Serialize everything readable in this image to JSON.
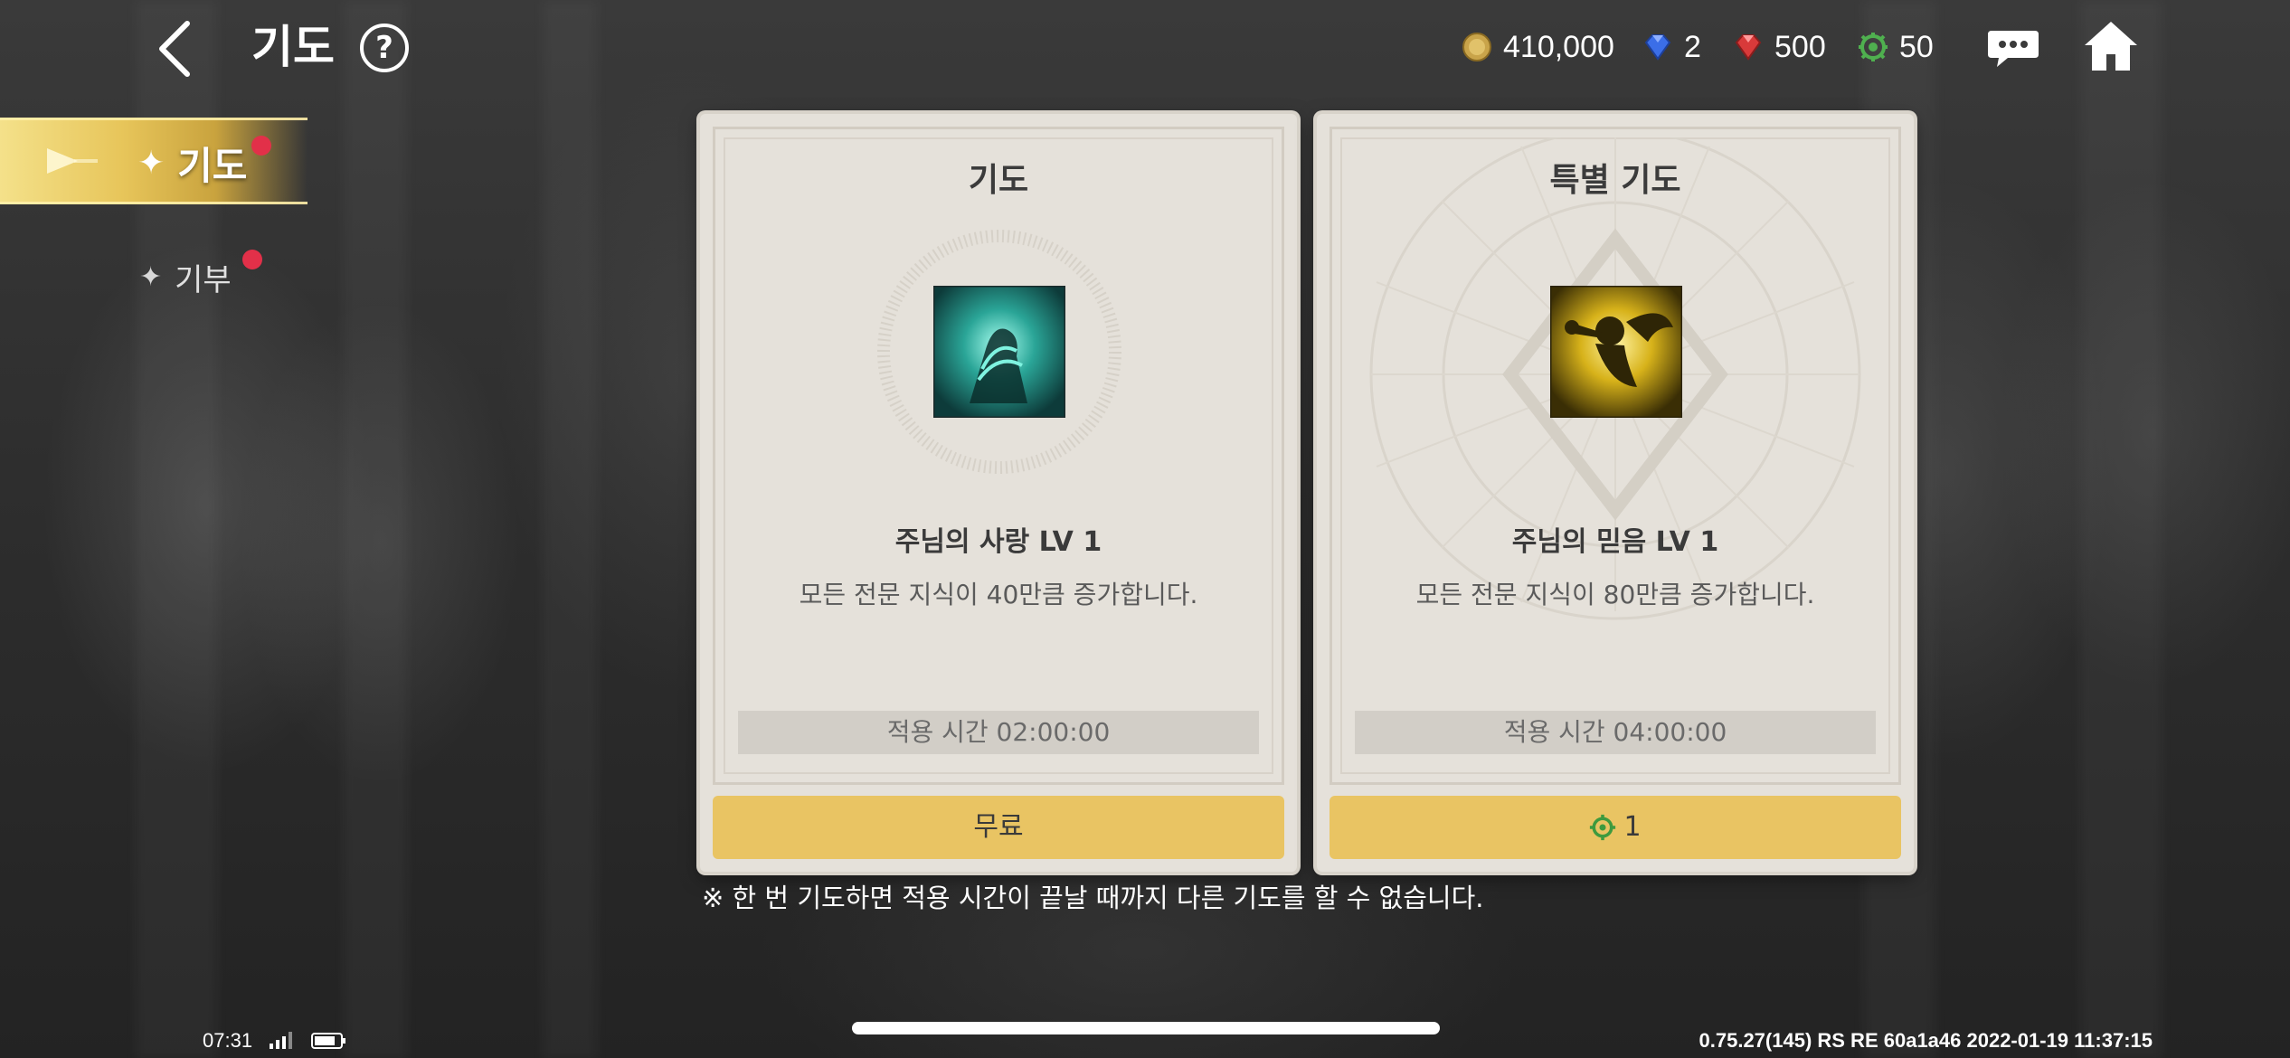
{
  "header": {
    "title": "기도",
    "back_icon": "chevron-left-icon",
    "help_label": "?",
    "currencies": [
      {
        "icon": "gold-coin-icon",
        "value": "410,000"
      },
      {
        "icon": "blue-gem-icon",
        "value": "2"
      },
      {
        "icon": "red-gem-icon",
        "value": "500"
      },
      {
        "icon": "green-emblem-icon",
        "value": "50"
      }
    ]
  },
  "sidebar": {
    "items": [
      {
        "label": "기도",
        "active": true,
        "badge": true
      },
      {
        "label": "기부",
        "active": false,
        "badge": true
      }
    ]
  },
  "cards": [
    {
      "title": "기도",
      "icon": "praying-hands-icon",
      "skill_name": "주님의 사랑 LV 1",
      "description": "모든 전문 지식이 40만큼 증가합니다.",
      "duration": "적용 시간 02:00:00",
      "button_label": "무료"
    },
    {
      "title": "특별 기도",
      "icon": "cherub-trumpet-icon",
      "skill_name": "주님의 믿음 LV 1",
      "description": "모든 전문 지식이 80만큼 증가합니다.",
      "duration": "적용 시간 04:00:00",
      "button_label": "1",
      "button_icon": "green-emblem-icon"
    }
  ],
  "note": "※ 한 번 기도하면 적용 시간이 끝날 때까지 다른 기도를 할 수 없습니다.",
  "status": {
    "time": "07:31",
    "build": "0.75.27(145) RS RE 60a1a46 2022-01-19 11:37:15"
  },
  "colors": {
    "accent_gold": "#e9c463",
    "card_bg": "#e5e1da",
    "badge_red": "#e23049"
  }
}
